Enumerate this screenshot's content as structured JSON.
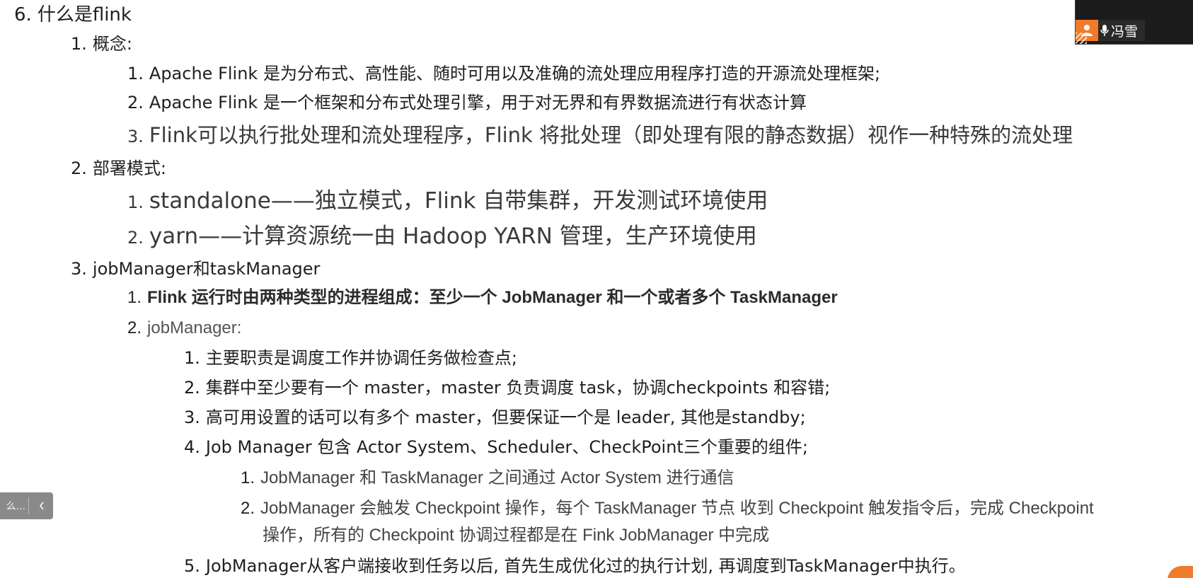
{
  "doc": {
    "h6": {
      "num": "6.",
      "text": "什么是flink"
    },
    "s1": {
      "num": "1.",
      "text": "概念:"
    },
    "s1_items": [
      {
        "num": "1.",
        "text": "Apache Flink 是为分布式、高性能、随时可用以及准确的流处理应用程序打造的开源流处理框架;"
      },
      {
        "num": "2.",
        "text": "Apache Flink 是一个框架和分布式处理引擎，用于对无界和有界数据流进行有状态计算"
      },
      {
        "num": "3.",
        "text": "Flink可以执行批处理和流处理程序，Flink 将批处理（即处理有限的静态数据）视作一种特殊的流处理"
      }
    ],
    "s2": {
      "num": "2.",
      "text": "部署模式:"
    },
    "s2_items": [
      {
        "num": "1.",
        "text": "standalone——独立模式，Flink 自带集群，开发测试环境使用"
      },
      {
        "num": "2.",
        "text": "yarn——计算资源统一由 Hadoop YARN 管理，生产环境使用"
      }
    ],
    "s3": {
      "num": "3.",
      "text": "jobManager和taskManager"
    },
    "s3_items": [
      {
        "num": "1.",
        "text": "Flink 运行时由两种类型的进程组成：至少一个 JobManager 和一个或者多个 TaskManager"
      },
      {
        "num": "2.",
        "text": "jobManager:"
      }
    ],
    "jm_items": [
      {
        "num": "1.",
        "text": "主要职责是调度工作并协调任务做检查点;"
      },
      {
        "num": "2.",
        "text": "集群中至少要有一个 master，master 负责调度 task，协调checkpoints 和容错;"
      },
      {
        "num": "3.",
        "text": "高可用设置的话可以有多个 master，但要保证一个是 leader, 其他是standby;"
      },
      {
        "num": "4.",
        "text": "Job Manager 包含 Actor System、Scheduler、CheckPoint三个重要的组件;"
      },
      {
        "num": "5.",
        "text": "JobManager从客户端接收到任务以后, 首先生成优化过的执行计划, 再调度到TaskManager中执行。"
      }
    ],
    "jm4_items": [
      {
        "num": "1.",
        "text": "JobManager 和 TaskManager 之间通过 Actor System 进行通信"
      },
      {
        "num": "2.",
        "text": "JobManager 会触发 Checkpoint 操作，每个 TaskManager 节点 收到 Checkpoint 触发指令后，完成 Checkpoint",
        "text2": "操作，所有的 Checkpoint 协调过程都是在 Fink JobManager 中完成"
      }
    ]
  },
  "video": {
    "speaker": "冯雪",
    "avatar_icon": "person-icon",
    "mic_icon": "microphone-icon",
    "accent": "#f07b2a"
  },
  "side_toolbar": {
    "label": "么...",
    "collapse_icon": "chevron-left-icon"
  }
}
